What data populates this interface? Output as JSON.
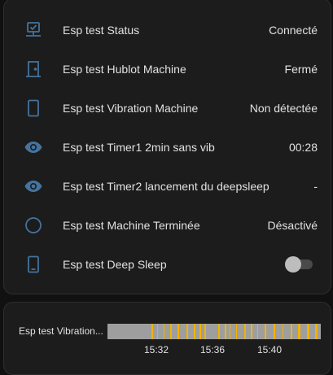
{
  "entities": [
    {
      "icon": "server-network-icon",
      "name": "Esp test Status",
      "state": "Connecté"
    },
    {
      "icon": "door-icon",
      "name": "Esp test Hublot Machine",
      "state": "Fermé"
    },
    {
      "icon": "phone-outline-icon",
      "name": "Esp test Vibration Machine",
      "state": "Non détectée"
    },
    {
      "icon": "eye-icon",
      "name": "Esp test Timer1 2min sans vib",
      "state": "00:28"
    },
    {
      "icon": "eye-icon",
      "name": "Esp test Timer2 lancement du deepsleep",
      "state": "-"
    },
    {
      "icon": "circle-outline-icon",
      "name": "Esp test Machine Terminée",
      "state": "Désactivé"
    },
    {
      "icon": "cellphone-icon",
      "name": "Esp test Deep Sleep",
      "toggle_on": false
    }
  ],
  "history": {
    "label": "Esp test Vibration...",
    "ticks": [
      "15:32",
      "15:36",
      "15:40"
    ],
    "colors": {
      "off": "#9e9e9e",
      "on": "#f0b400",
      "icon": "#44739e"
    },
    "on_segments": [
      [
        0.205,
        0.215
      ],
      [
        0.232,
        0.238
      ],
      [
        0.262,
        0.268
      ],
      [
        0.293,
        0.3
      ],
      [
        0.33,
        0.336
      ],
      [
        0.37,
        0.376
      ],
      [
        0.405,
        0.414
      ],
      [
        0.432,
        0.438
      ],
      [
        0.455,
        0.46
      ],
      [
        0.52,
        0.526
      ],
      [
        0.548,
        0.558
      ],
      [
        0.572,
        0.578
      ],
      [
        0.602,
        0.608
      ],
      [
        0.64,
        0.65
      ],
      [
        0.672,
        0.678
      ],
      [
        0.702,
        0.708
      ],
      [
        0.735,
        0.745
      ],
      [
        0.78,
        0.786
      ],
      [
        0.82,
        0.826
      ],
      [
        0.86,
        0.868
      ],
      [
        0.895,
        0.903
      ],
      [
        0.935,
        0.945
      ],
      [
        0.975,
        0.985
      ]
    ]
  }
}
